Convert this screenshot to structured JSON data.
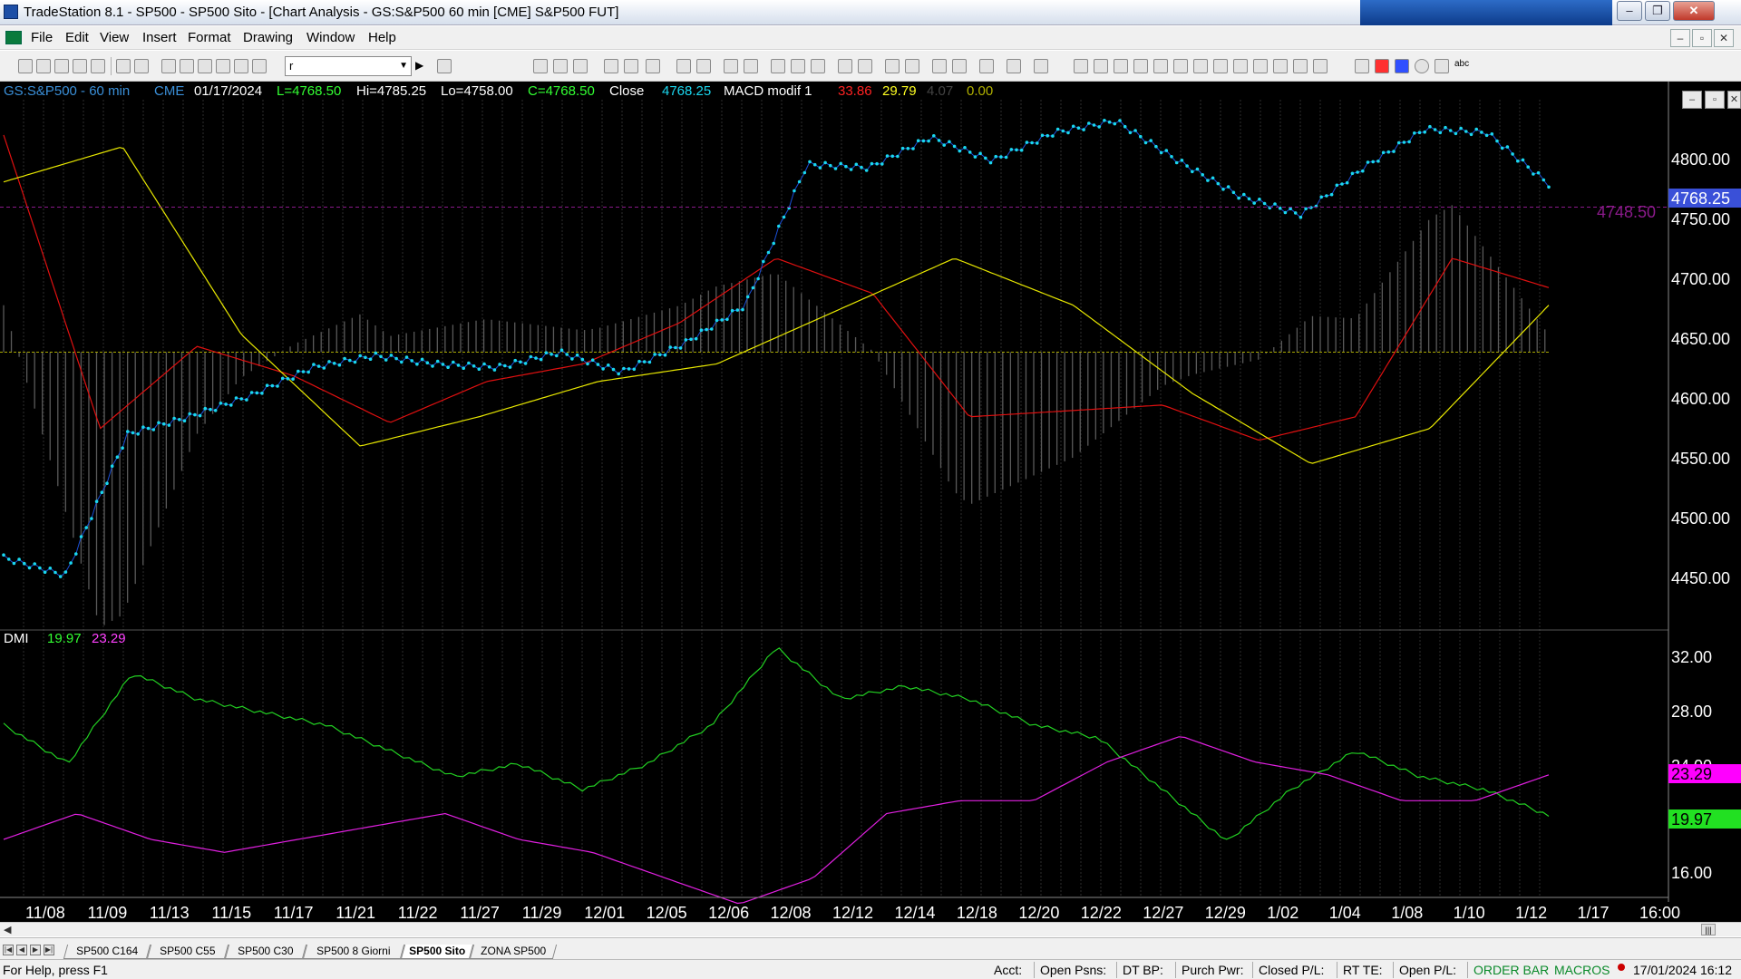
{
  "window": {
    "title": "TradeStation 8.1 - SP500 - SP500 Sito - [Chart Analysis - GS:S&P500  60 min  [CME] S&P500 FUT]",
    "controls": [
      "–",
      "❐",
      "✕"
    ]
  },
  "menu": {
    "items": [
      "File",
      "Edit",
      "View",
      "Insert",
      "Format",
      "Drawing",
      "Window",
      "Help"
    ],
    "mdi_controls": [
      "–",
      "▫",
      "✕"
    ]
  },
  "toolbar": {
    "symbol_combo_value": "r"
  },
  "header": {
    "symbol": "GS:S&P500 - 60 min",
    "exchange": "CME",
    "date": "01/17/2024",
    "last": "L=4768.50",
    "hi": "Hi=4785.25",
    "lo": "Lo=4758.00",
    "close_val": "C=4768.50",
    "close_label": "Close",
    "close_value": "4768.25",
    "macd_name": "MACD modif 1",
    "macd_v1": "33.86",
    "macd_v2": "29.79",
    "macd_v3": "4.07",
    "macd_v4": "0.00",
    "colors": {
      "label": "#1ad7ef",
      "green": "#32ff32",
      "white": "#ffffff",
      "red": "#ff2222",
      "yellow": "#ffff22",
      "dim": "#3a3a3a",
      "olive": "#b0b000"
    }
  },
  "dmi": {
    "name": "DMI",
    "v_plus": "19.97",
    "v_minus": "23.29"
  },
  "price_axis": {
    "ticks": [
      "4800.00",
      "4750.00",
      "4700.00",
      "4650.00",
      "4600.00",
      "4550.00",
      "4500.00",
      "4450.00"
    ],
    "current_price": "4768.25",
    "ref_price": "4748.50"
  },
  "dmi_axis": {
    "ticks": [
      "32.00",
      "28.00",
      "24.00",
      "16.00"
    ],
    "plus_value": "19.97",
    "minus_value": "23.29"
  },
  "date_axis": [
    "11/08",
    "11/09",
    "11/13",
    "11/15",
    "11/17",
    "11/21",
    "11/22",
    "11/27",
    "11/29",
    "12/01",
    "12/05",
    "12/06",
    "12/08",
    "12/12",
    "12/14",
    "12/18",
    "12/20",
    "12/22",
    "12/27",
    "12/29",
    "1/02",
    "1/04",
    "1/08",
    "1/10",
    "1/12",
    "1/17",
    "16:00"
  ],
  "chart_data": {
    "type": "line",
    "price": {
      "x": [
        "11/08",
        "11/09",
        "11/13",
        "11/15",
        "11/17",
        "11/21",
        "11/22",
        "11/27",
        "11/29",
        "12/01",
        "12/05",
        "12/06",
        "12/08",
        "12/12",
        "12/14",
        "12/18",
        "12/20",
        "12/22",
        "12/27",
        "12/29",
        "1/02",
        "1/04",
        "1/08",
        "1/10",
        "1/12",
        "1/17"
      ],
      "values": [
        4450,
        4435,
        4555,
        4570,
        4588,
        4612,
        4622,
        4615,
        4612,
        4625,
        4608,
        4632,
        4665,
        4785,
        4782,
        4808,
        4788,
        4812,
        4822,
        4788,
        4758,
        4742,
        4782,
        4815,
        4812,
        4768
      ],
      "ylim": [
        4400,
        4840
      ],
      "ytick_step": 50
    },
    "macd_line_red": [
      4810,
      4560,
      4630,
      4605,
      4565,
      4600,
      4615,
      4650,
      4705,
      4675,
      4570,
      4575,
      4580,
      4550,
      4570,
      4705,
      4680
    ],
    "signal_line_yellow": [
      4770,
      4800,
      4640,
      4545,
      4570,
      4600,
      4615,
      4660,
      4705,
      4665,
      4590,
      4530,
      4560,
      4665
    ],
    "histogram_zero": 4625,
    "dmi": {
      "plus": [
        27,
        24,
        31,
        29,
        28,
        27,
        25,
        23,
        24,
        22,
        24,
        27,
        33,
        29,
        30,
        29,
        27,
        26,
        22,
        18,
        22,
        25,
        23,
        22,
        20
      ],
      "minus": [
        18,
        20,
        18,
        17,
        18,
        19,
        20,
        18,
        17,
        15,
        13,
        15,
        20,
        21,
        21,
        24,
        26,
        24,
        23,
        21,
        21,
        23
      ],
      "ylim": [
        14,
        34
      ]
    }
  },
  "scrollbar": {
    "left_arrow": "◀",
    "right_glyph": "|||"
  },
  "tabs": {
    "nav": [
      "|◀",
      "◀",
      "▶",
      "▶|"
    ],
    "items": [
      "SP500 C164",
      "SP500 C55",
      "SP500 C30",
      "SP500 8 Giorni",
      "SP500 Sito",
      "ZONA SP500"
    ],
    "active_index": 4
  },
  "statusbar": {
    "help": "For Help, press F1",
    "acct": "Acct:",
    "open_psns": "Open Psns:",
    "dt_bp": "DT BP:",
    "purch_pwr": "Purch Pwr:",
    "closed_pl": "Closed P/L:",
    "rt_te": "RT TE:",
    "open_pl": "Open P/L:",
    "order_bar": "ORDER BAR",
    "macros": "MACROS",
    "datetime": "17/01/2024 16:12"
  }
}
